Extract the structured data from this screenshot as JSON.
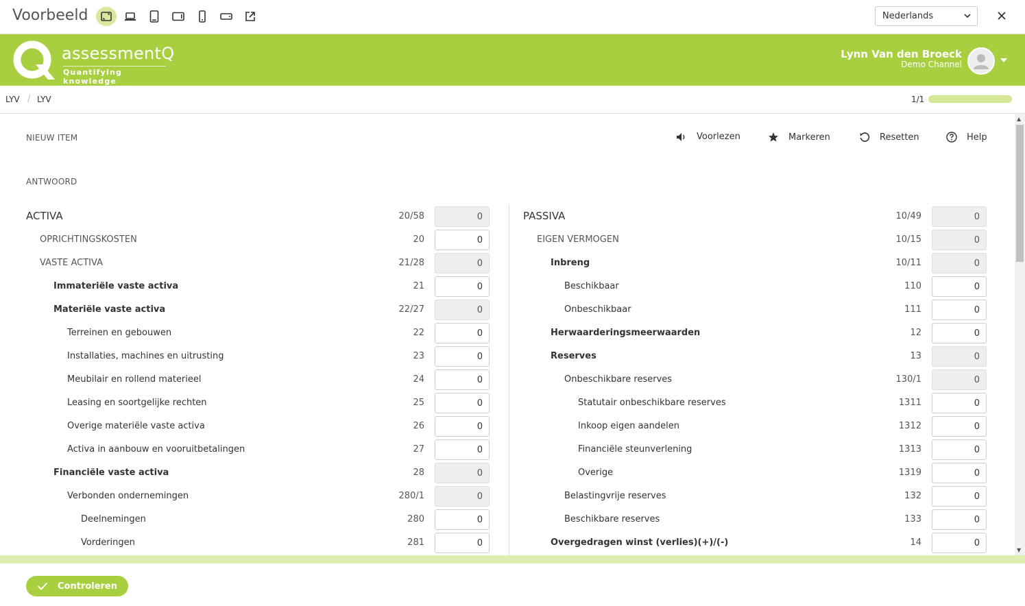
{
  "topbar": {
    "title": "Voorbeeld",
    "language": "Nederlands"
  },
  "header": {
    "brand": "assessmentQ",
    "tagline": "Quantifying knowledge",
    "user_name": "Lynn Van den Broeck",
    "user_channel": "Demo Channel"
  },
  "breadcrumb": {
    "items": [
      "LYV",
      "LYV"
    ],
    "separator": "/",
    "progress_text": "1/1",
    "progress_fraction": 1.0
  },
  "main": {
    "item_label": "NIEUW ITEM",
    "answer_label": "ANTWOORD",
    "tools": {
      "read": "Voorlezen",
      "mark": "Markeren",
      "reset": "Resetten",
      "help": "Help"
    },
    "left": [
      {
        "label": "ACTIVA",
        "code": "20/58",
        "value": "0",
        "level": 0,
        "bold": false,
        "readonly": true
      },
      {
        "label": "OPRICHTINGSKOSTEN",
        "code": "20",
        "value": "0",
        "level": 1,
        "bold": false,
        "readonly": false
      },
      {
        "label": "VASTE ACTIVA",
        "code": "21/28",
        "value": "0",
        "level": 1,
        "bold": false,
        "readonly": true
      },
      {
        "label": "Immateriële vaste activa",
        "code": "21",
        "value": "0",
        "level": 2,
        "bold": true,
        "readonly": false
      },
      {
        "label": "Materiële vaste activa",
        "code": "22/27",
        "value": "0",
        "level": 2,
        "bold": true,
        "readonly": true
      },
      {
        "label": "Terreinen en gebouwen",
        "code": "22",
        "value": "0",
        "level": 3,
        "bold": false,
        "readonly": false
      },
      {
        "label": "Installaties, machines en uitrusting",
        "code": "23",
        "value": "0",
        "level": 3,
        "bold": false,
        "readonly": false
      },
      {
        "label": "Meubilair en rollend materieel",
        "code": "24",
        "value": "0",
        "level": 3,
        "bold": false,
        "readonly": false
      },
      {
        "label": "Leasing en soortgelijke rechten",
        "code": "25",
        "value": "0",
        "level": 3,
        "bold": false,
        "readonly": false
      },
      {
        "label": "Overige materiële vaste activa",
        "code": "26",
        "value": "0",
        "level": 3,
        "bold": false,
        "readonly": false
      },
      {
        "label": "Activa in aanbouw en vooruitbetalingen",
        "code": "27",
        "value": "0",
        "level": 3,
        "bold": false,
        "readonly": false
      },
      {
        "label": "Financiële vaste activa",
        "code": "28",
        "value": "0",
        "level": 2,
        "bold": true,
        "readonly": true
      },
      {
        "label": "Verbonden ondernemingen",
        "code": "280/1",
        "value": "0",
        "level": 3,
        "bold": false,
        "readonly": true
      },
      {
        "label": "Deelnemingen",
        "code": "280",
        "value": "0",
        "level": 4,
        "bold": false,
        "readonly": false
      },
      {
        "label": "Vorderingen",
        "code": "281",
        "value": "0",
        "level": 4,
        "bold": false,
        "readonly": false
      }
    ],
    "right": [
      {
        "label": "PASSIVA",
        "code": "10/49",
        "value": "0",
        "level": 0,
        "bold": false,
        "readonly": true
      },
      {
        "label": "EIGEN VERMOGEN",
        "code": "10/15",
        "value": "0",
        "level": 1,
        "bold": false,
        "readonly": true
      },
      {
        "label": "Inbreng",
        "code": "10/11",
        "value": "0",
        "level": 2,
        "bold": true,
        "readonly": true
      },
      {
        "label": "Beschikbaar",
        "code": "110",
        "value": "0",
        "level": 3,
        "bold": false,
        "readonly": false
      },
      {
        "label": "Onbeschikbaar",
        "code": "111",
        "value": "0",
        "level": 3,
        "bold": false,
        "readonly": false
      },
      {
        "label": "Herwaarderingsmeerwaarden",
        "code": "12",
        "value": "0",
        "level": 2,
        "bold": true,
        "readonly": false
      },
      {
        "label": "Reserves",
        "code": "13",
        "value": "0",
        "level": 2,
        "bold": true,
        "readonly": true
      },
      {
        "label": "Onbeschikbare reserves",
        "code": "130/1",
        "value": "0",
        "level": 3,
        "bold": false,
        "readonly": true
      },
      {
        "label": "Statutair onbeschikbare reserves",
        "code": "1311",
        "value": "0",
        "level": 4,
        "bold": false,
        "readonly": false
      },
      {
        "label": "Inkoop eigen aandelen",
        "code": "1312",
        "value": "0",
        "level": 4,
        "bold": false,
        "readonly": false
      },
      {
        "label": "Financiële steunverlening",
        "code": "1313",
        "value": "0",
        "level": 4,
        "bold": false,
        "readonly": false
      },
      {
        "label": "Overige",
        "code": "1319",
        "value": "0",
        "level": 4,
        "bold": false,
        "readonly": false
      },
      {
        "label": "Belastingvrije reserves",
        "code": "132",
        "value": "0",
        "level": 3,
        "bold": false,
        "readonly": false
      },
      {
        "label": "Beschikbare reserves",
        "code": "133",
        "value": "0",
        "level": 3,
        "bold": false,
        "readonly": false
      },
      {
        "label": "Overgedragen winst (verlies)(+)/(-)",
        "code": "14",
        "value": "0",
        "level": 2,
        "bold": true,
        "readonly": false
      }
    ]
  },
  "footer": {
    "check_label": "Controleren"
  },
  "colors": {
    "brand_green": "#a8cf3f",
    "readonly_bg": "#eeeeee"
  }
}
